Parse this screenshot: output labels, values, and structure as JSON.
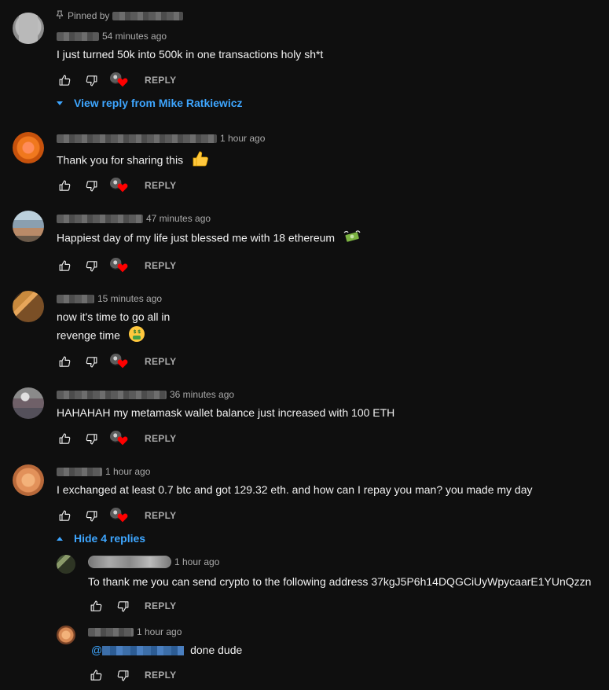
{
  "pinned": {
    "label": "Pinned by"
  },
  "comments": [
    {
      "time": "54 minutes ago",
      "text": "I just turned 50k into 500k in one transactions holy sh*t",
      "reply_label": "REPLY",
      "view_reply": "View reply from Mike Ratkiewicz"
    },
    {
      "time": "1 hour ago",
      "text": "Thank you for sharing this",
      "emoji": "thumbs-up",
      "reply_label": "REPLY"
    },
    {
      "time": "47 minutes ago",
      "text": "Happiest day of my life just blessed me with 18 ethereum",
      "emoji": "money-with-wings",
      "reply_label": "REPLY"
    },
    {
      "time": "15 minutes ago",
      "line1": "now it's time to go all in",
      "line2": "revenge time",
      "emoji": "money-mouth-face",
      "reply_label": "REPLY"
    },
    {
      "time": "36 minutes ago",
      "text": "HAHAHAH my metamask wallet balance just increased with 100 ETH",
      "reply_label": "REPLY"
    },
    {
      "time": "1 hour ago",
      "text": "I exchanged at least 0.7 btc and got 129.32 eth. and how can I repay you man? you made my day",
      "reply_label": "REPLY",
      "hide_replies": "Hide 4 replies"
    }
  ],
  "replies": [
    {
      "time": "1 hour ago",
      "text": "To thank me you can send crypto to the following address 37kgJ5P6h14DQGCiUyWpycaarE1YUnQzzn",
      "reply_label": "REPLY"
    },
    {
      "time": "1 hour ago",
      "mention_prefix": "@",
      "text": "done dude",
      "reply_label": "REPLY"
    }
  ],
  "colors": {
    "background": "#0f0f0f",
    "link_blue": "#3ea6ff",
    "heart_red": "#ff0000",
    "muted": "#aaaaaa"
  }
}
